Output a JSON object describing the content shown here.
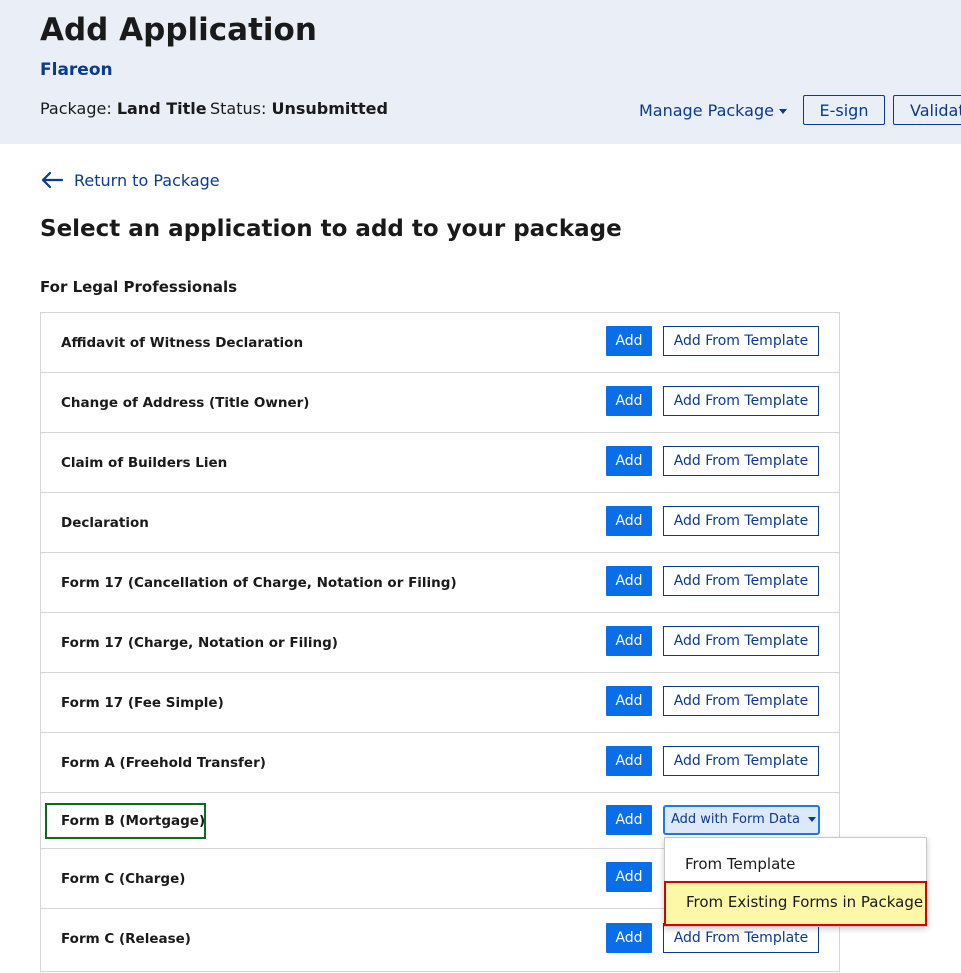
{
  "header": {
    "title": "Add Application",
    "subtitle": "Flareon",
    "package_label": "Package:",
    "package_value": "Land Title",
    "status_label": "Status:",
    "status_value": "Unsubmitted",
    "manage_package": "Manage Package",
    "esign": "E-sign",
    "validate": "Validat"
  },
  "nav": {
    "return_label": "Return to Package"
  },
  "page": {
    "heading": "Select an application to add to your package",
    "section": "For Legal Professionals"
  },
  "buttons": {
    "add": "Add",
    "add_from_template": "Add From Template",
    "add_with_form_data": "Add with Form Data"
  },
  "applications": [
    "Affidavit of Witness Declaration",
    "Change of Address (Title Owner)",
    "Claim of Builders Lien",
    "Declaration",
    "Form 17 (Cancellation of Charge, Notation or Filing)",
    "Form 17 (Charge, Notation or Filing)",
    "Form 17 (Fee Simple)",
    "Form A (Freehold Transfer)",
    "Form B (Mortgage)",
    "Form C (Charge)",
    "Form C (Release)"
  ],
  "dropdown": {
    "from_template": "From Template",
    "from_existing": "From Existing Forms in Package"
  },
  "colors": {
    "header_bg": "#eaeff7",
    "brand_blue": "#0b3a8f",
    "add_button": "#0a6ee8",
    "highlight_green": "#0d6b1e",
    "highlight_red": "#d90000",
    "highlight_yellow": "#fcf8a8"
  }
}
